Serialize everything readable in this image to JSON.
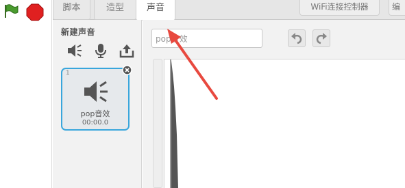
{
  "toolbar": {
    "flag_icon": "green-flag-icon",
    "stop_icon": "stop-sign-icon"
  },
  "tabs": [
    {
      "label": "脚本"
    },
    {
      "label": "造型"
    },
    {
      "label": "声音"
    }
  ],
  "top_buttons": {
    "wifi_label": "WiFi连接控制器",
    "edit_label": "编"
  },
  "sound_panel": {
    "new_sound_label": "新建声音",
    "new_icons": [
      "speaker-library-icon",
      "microphone-icon",
      "upload-icon"
    ],
    "sounds": [
      {
        "index": "1",
        "name": "pop音效",
        "duration": "00:00.0"
      }
    ]
  },
  "editor": {
    "sound_name_value": "pop音效",
    "undo_icon": "undo-icon",
    "redo_icon": "redo-icon"
  },
  "colors": {
    "selection_border": "#39a6dc",
    "annotation_arrow": "#e8493f",
    "flag_green": "#3f8f2a",
    "stop_red": "#e02020"
  }
}
